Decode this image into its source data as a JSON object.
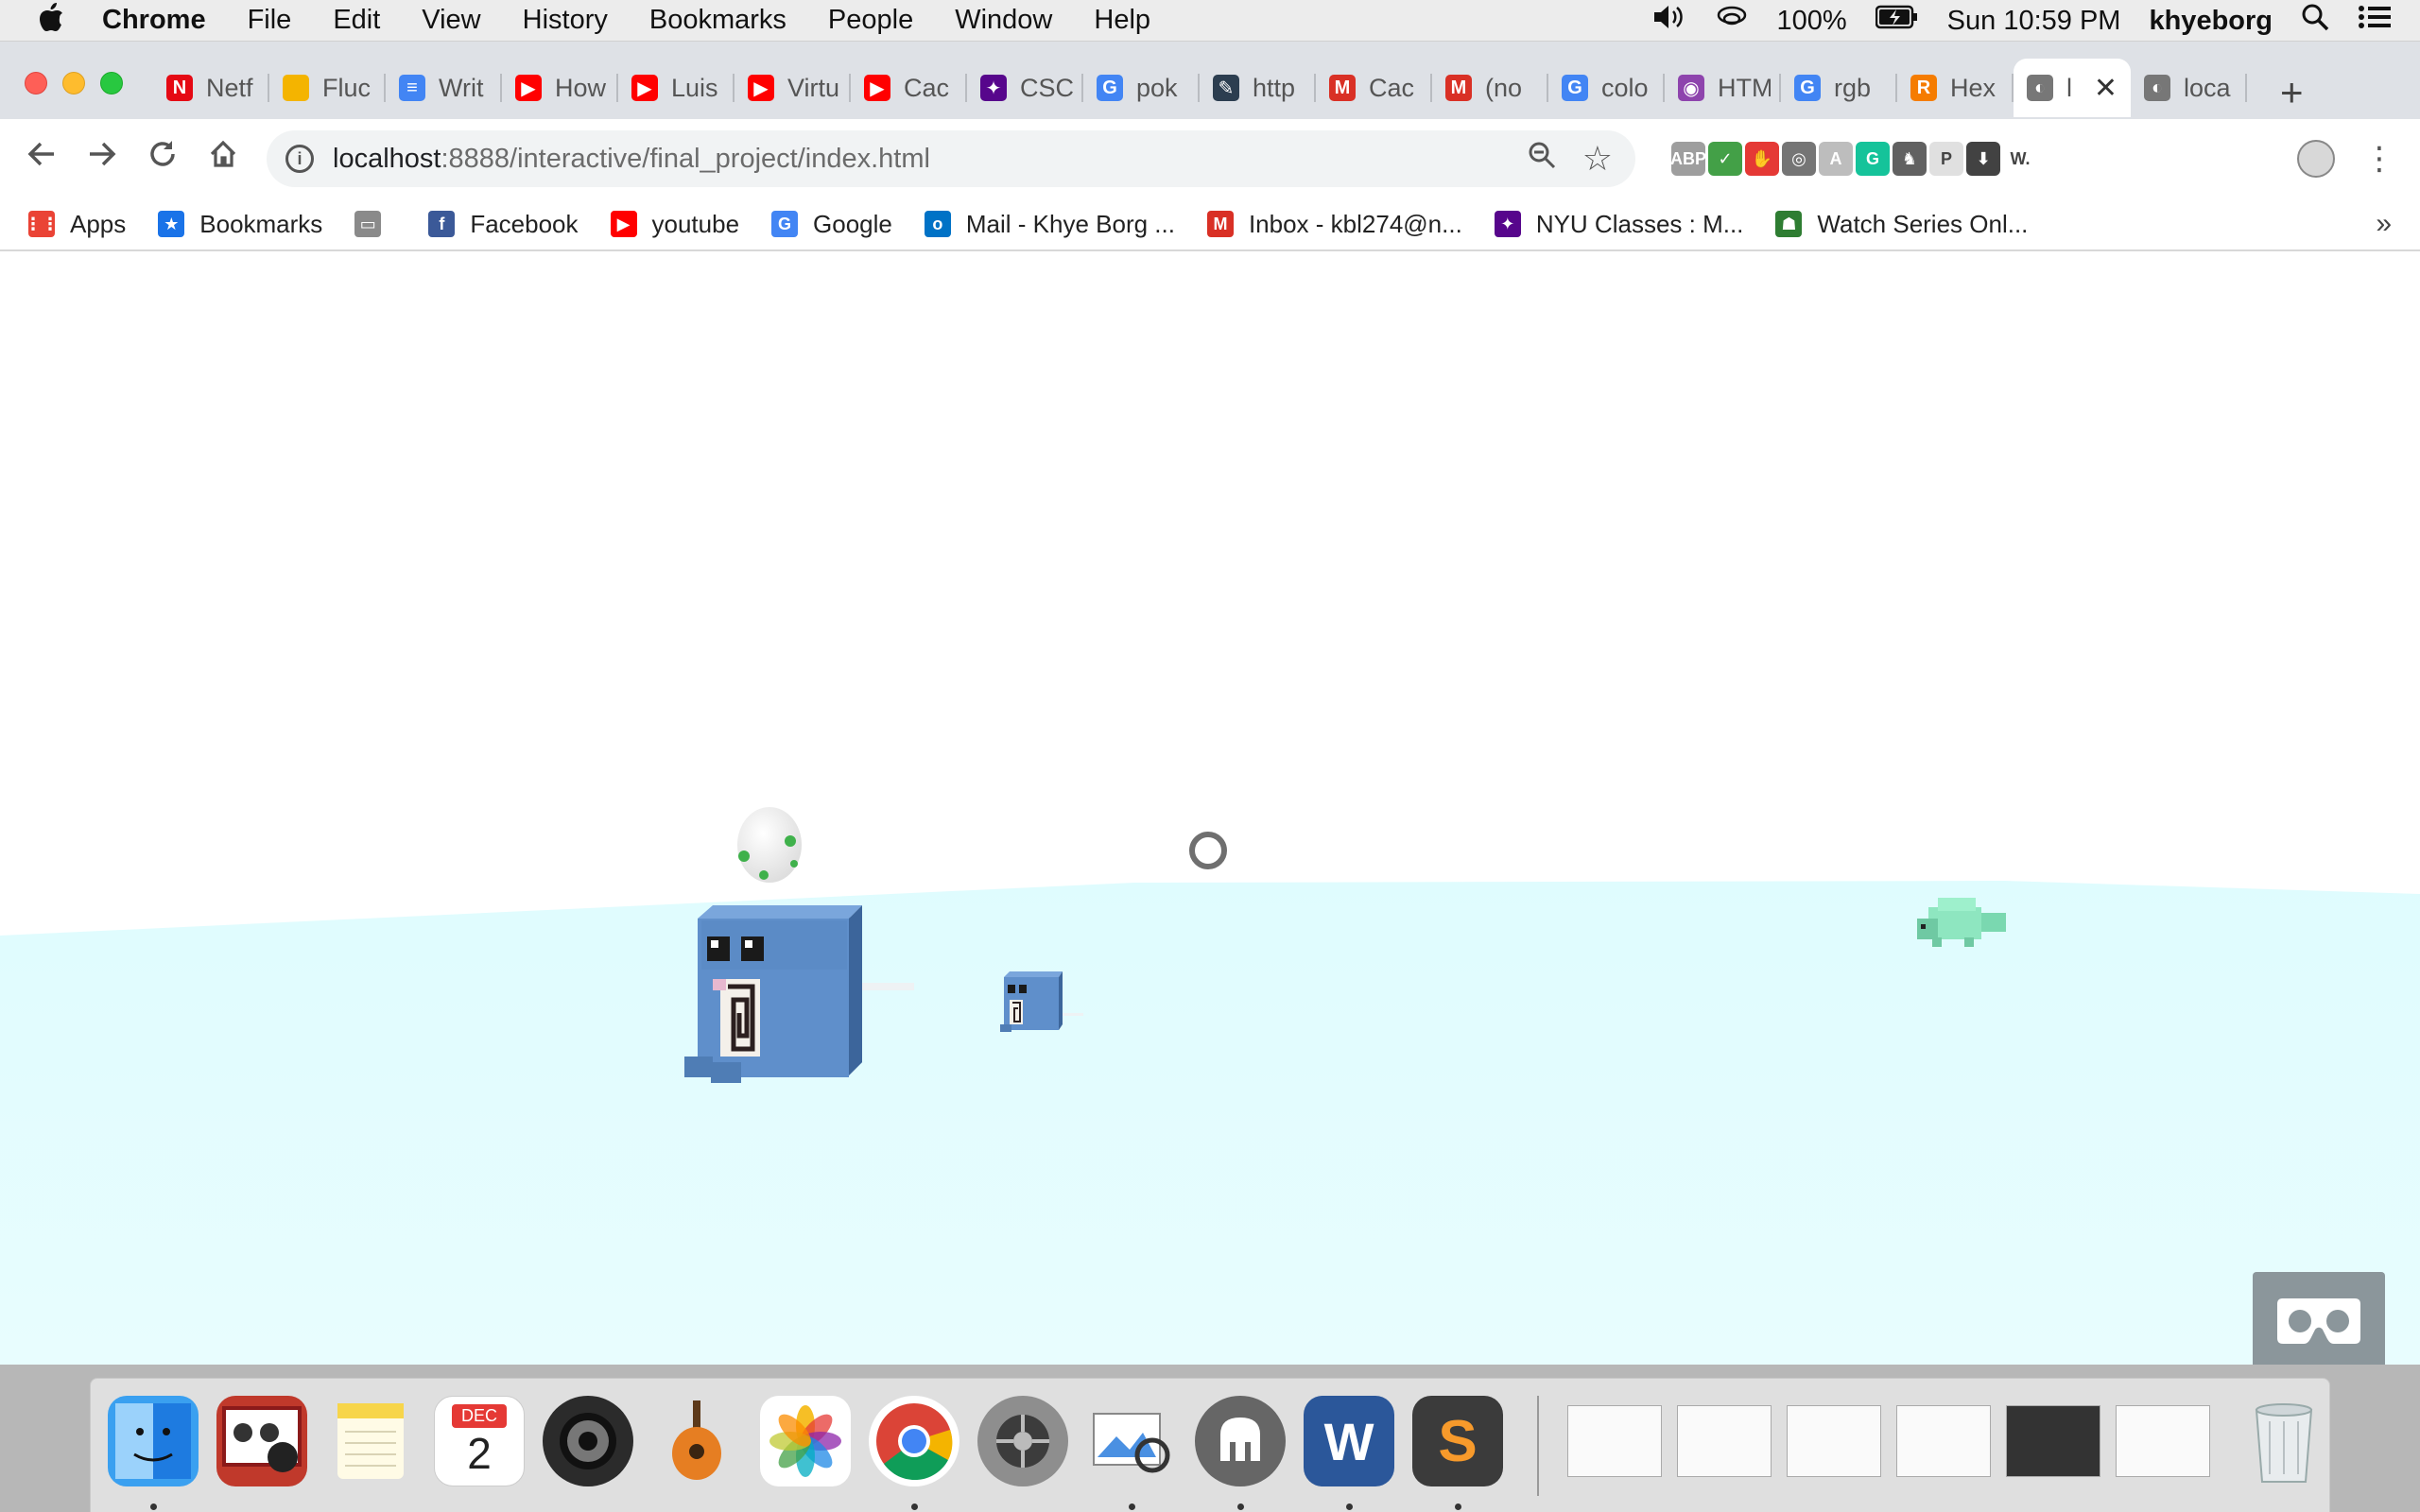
{
  "menubar": {
    "app_name": "Chrome",
    "menus": [
      "File",
      "Edit",
      "View",
      "History",
      "Bookmarks",
      "People",
      "Window",
      "Help"
    ],
    "battery": "100%",
    "clock": "Sun 10:59 PM",
    "user": "khyeborg"
  },
  "tabs": [
    {
      "label": "Netf",
      "favicon": "netflix-icon",
      "color": "#e50914",
      "glyph": "N"
    },
    {
      "label": "Fluc",
      "favicon": "slides-icon",
      "color": "#f4b400",
      "glyph": ""
    },
    {
      "label": "Writ",
      "favicon": "docs-icon",
      "color": "#4285f4",
      "glyph": "≡"
    },
    {
      "label": "How",
      "favicon": "youtube-icon",
      "color": "#ff0000",
      "glyph": "▶"
    },
    {
      "label": "Luis",
      "favicon": "youtube-icon",
      "color": "#ff0000",
      "glyph": "▶"
    },
    {
      "label": "Virtu",
      "favicon": "youtube-icon",
      "color": "#ff0000",
      "glyph": "▶"
    },
    {
      "label": "Cac",
      "favicon": "youtube-icon",
      "color": "#ff0000",
      "glyph": "▶"
    },
    {
      "label": "CSC",
      "favicon": "nyu-icon",
      "color": "#57068c",
      "glyph": "✦"
    },
    {
      "label": "pok",
      "favicon": "google-icon",
      "color": "#4285f4",
      "glyph": "G"
    },
    {
      "label": "http",
      "favicon": "quill-icon",
      "color": "#2c3e50",
      "glyph": "✎"
    },
    {
      "label": "Cac",
      "favicon": "gmail-icon",
      "color": "#d93025",
      "glyph": "M"
    },
    {
      "label": "(no",
      "favicon": "gmail-icon",
      "color": "#d93025",
      "glyph": "M"
    },
    {
      "label": "colo",
      "favicon": "google-icon",
      "color": "#4285f4",
      "glyph": "G"
    },
    {
      "label": "HTM",
      "favicon": "color-wheel-icon",
      "color": "#8e44ad",
      "glyph": "◉"
    },
    {
      "label": "rgb",
      "favicon": "google-icon",
      "color": "#4285f4",
      "glyph": "G"
    },
    {
      "label": "Hex",
      "favicon": "r-icon",
      "color": "#f57c00",
      "glyph": "R"
    },
    {
      "label": "l",
      "favicon": "mamp-icon",
      "color": "#777777",
      "glyph": "◐",
      "active": true
    },
    {
      "label": "loca",
      "favicon": "mamp-icon",
      "color": "#777777",
      "glyph": "◐"
    }
  ],
  "toolbar": {
    "url_host": "localhost",
    "url_path": ":8888/interactive/final_project/index.html",
    "extensions": [
      {
        "name": "abp-icon",
        "color": "#9e9e9e",
        "glyph": "ABP"
      },
      {
        "name": "shield-icon",
        "color": "#43a047",
        "glyph": "✓"
      },
      {
        "name": "stop-hand-icon",
        "color": "#e53935",
        "glyph": "✋"
      },
      {
        "name": "film-reel-icon",
        "color": "#757575",
        "glyph": "◎"
      },
      {
        "name": "translate-icon",
        "color": "#bdbdbd",
        "glyph": "A"
      },
      {
        "name": "grammarly-icon",
        "color": "#15c39a",
        "glyph": "G"
      },
      {
        "name": "horse-icon",
        "color": "#616161",
        "glyph": "♞"
      },
      {
        "name": "dashed-box-icon",
        "color": "#e0e0e0",
        "glyph": "P"
      },
      {
        "name": "download-icon",
        "color": "#424242",
        "glyph": "⬇"
      },
      {
        "name": "wappalyzer-icon",
        "color": "#ffffff",
        "glyph": "W."
      }
    ]
  },
  "bookmarks": [
    {
      "label": "Apps",
      "icon": "apps-grid-icon",
      "color": "#ea4335",
      "glyph": "⋮⋮"
    },
    {
      "label": "Bookmarks",
      "icon": "star-icon",
      "color": "#1a73e8",
      "glyph": "★"
    },
    {
      "label": "",
      "icon": "folder-icon",
      "color": "#8a8a8a",
      "glyph": "▭"
    },
    {
      "label": "Facebook",
      "icon": "facebook-icon",
      "color": "#3b5998",
      "glyph": "f"
    },
    {
      "label": "youtube",
      "icon": "youtube-icon",
      "color": "#ff0000",
      "glyph": "▶"
    },
    {
      "label": "Google",
      "icon": "google-icon",
      "color": "#4285f4",
      "glyph": "G"
    },
    {
      "label": "Mail - Khye Borg ...",
      "icon": "outlook-icon",
      "color": "#0072c6",
      "glyph": "o"
    },
    {
      "label": "Inbox - kbl274@n...",
      "icon": "gmail-icon",
      "color": "#d93025",
      "glyph": "M"
    },
    {
      "label": "NYU Classes : M...",
      "icon": "nyu-icon",
      "color": "#57068c",
      "glyph": "✦"
    },
    {
      "label": "Watch Series Onl...",
      "icon": "watch-series-icon",
      "color": "#2e7d32",
      "glyph": "☗"
    }
  ],
  "scene": {
    "ground_color": "#d9fbfd",
    "character_color": "#4f7db5",
    "egg_spot_color": "#3fb14b",
    "turtle_color": "#8ee6c0"
  },
  "dock": {
    "apps": [
      "finder-icon",
      "photo-booth-icon",
      "notes-icon",
      "calendar-icon",
      "logic-icon",
      "garageband-icon",
      "photos-icon",
      "chrome-icon",
      "system-preferences-icon",
      "preview-icon",
      "mamp-icon",
      "word-icon",
      "sublime-text-icon"
    ],
    "calendar_month": "DEC",
    "calendar_day": "2"
  }
}
